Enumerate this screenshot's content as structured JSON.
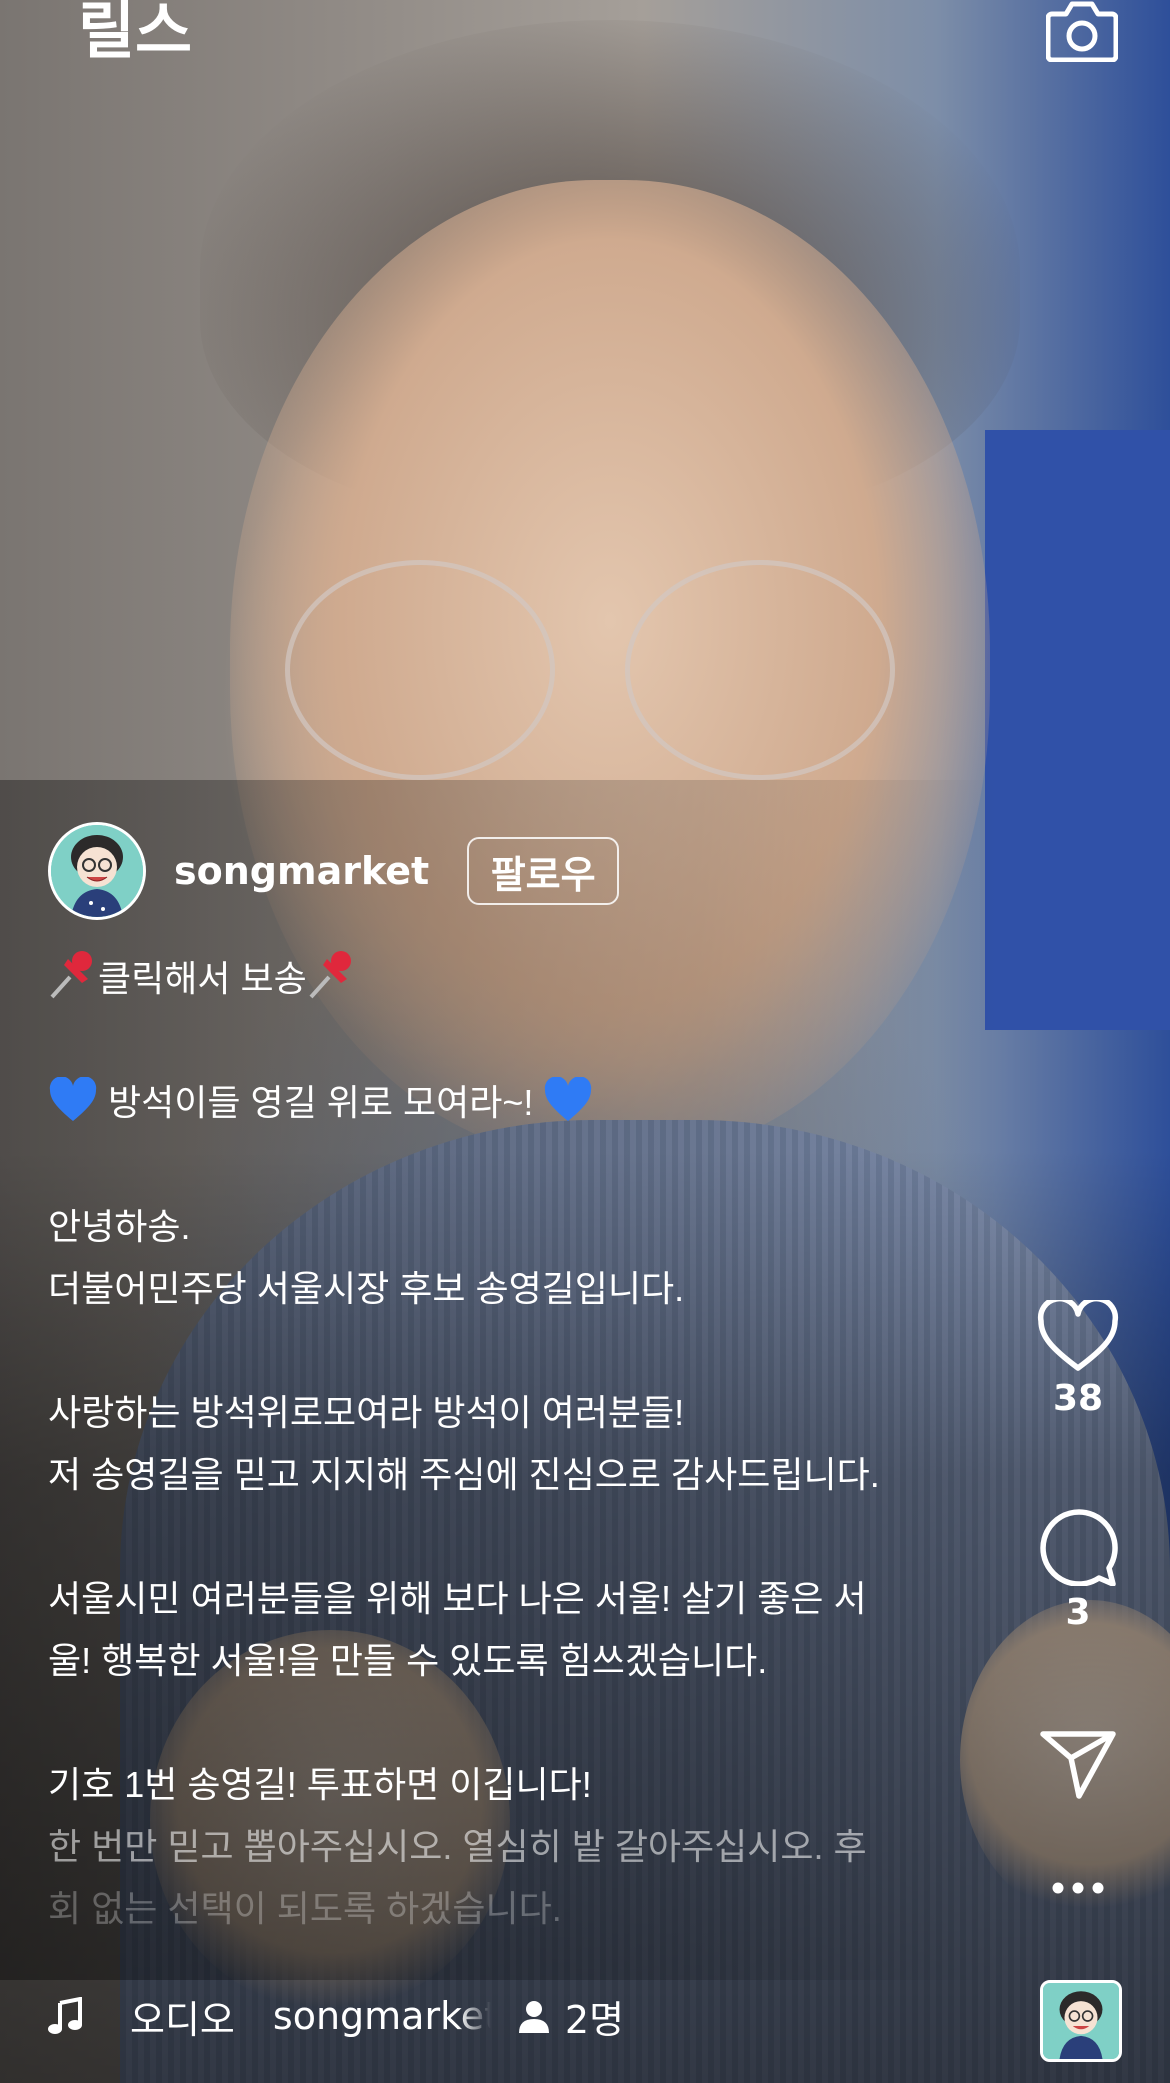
{
  "header": {
    "title": "릴스",
    "camera_icon": "camera-icon"
  },
  "author": {
    "username": "songmarket",
    "follow_label": "팔로우"
  },
  "caption": {
    "lines": [
      "클릭해서 보송",
      "",
      " 방석이들 영길 위로 모여라~! ",
      "",
      "안녕하송.",
      "더불어민주당 서울시장 후보 송영길입니다.",
      "",
      "사랑하는 방석위로모여라 방석이 여러분들!",
      "저 송영길을 믿고 지지해 주심에 진심으로 감사드립니다.",
      "",
      "서울시민 여러분들을 위해 보다 나은 서울! 살기 좋은 서",
      "울! 행복한 서울!을 만들 수 있도록 힘쓰겠습니다.",
      "",
      "기호 1번 송영길! 투표하면 이깁니다!",
      "한 번만 믿고 뽑아주십시오. 열심히 밭 갈아주십시오. 후",
      "회 없는 선택이 되도록 하겠습니다."
    ]
  },
  "actions": {
    "likes": "38",
    "comments": "3"
  },
  "audio": {
    "label": "오디오",
    "artist": "songmarket",
    "users": "2명"
  },
  "colors": {
    "accent_blue": "#2f7bf5",
    "pin_red": "#e0283c"
  }
}
